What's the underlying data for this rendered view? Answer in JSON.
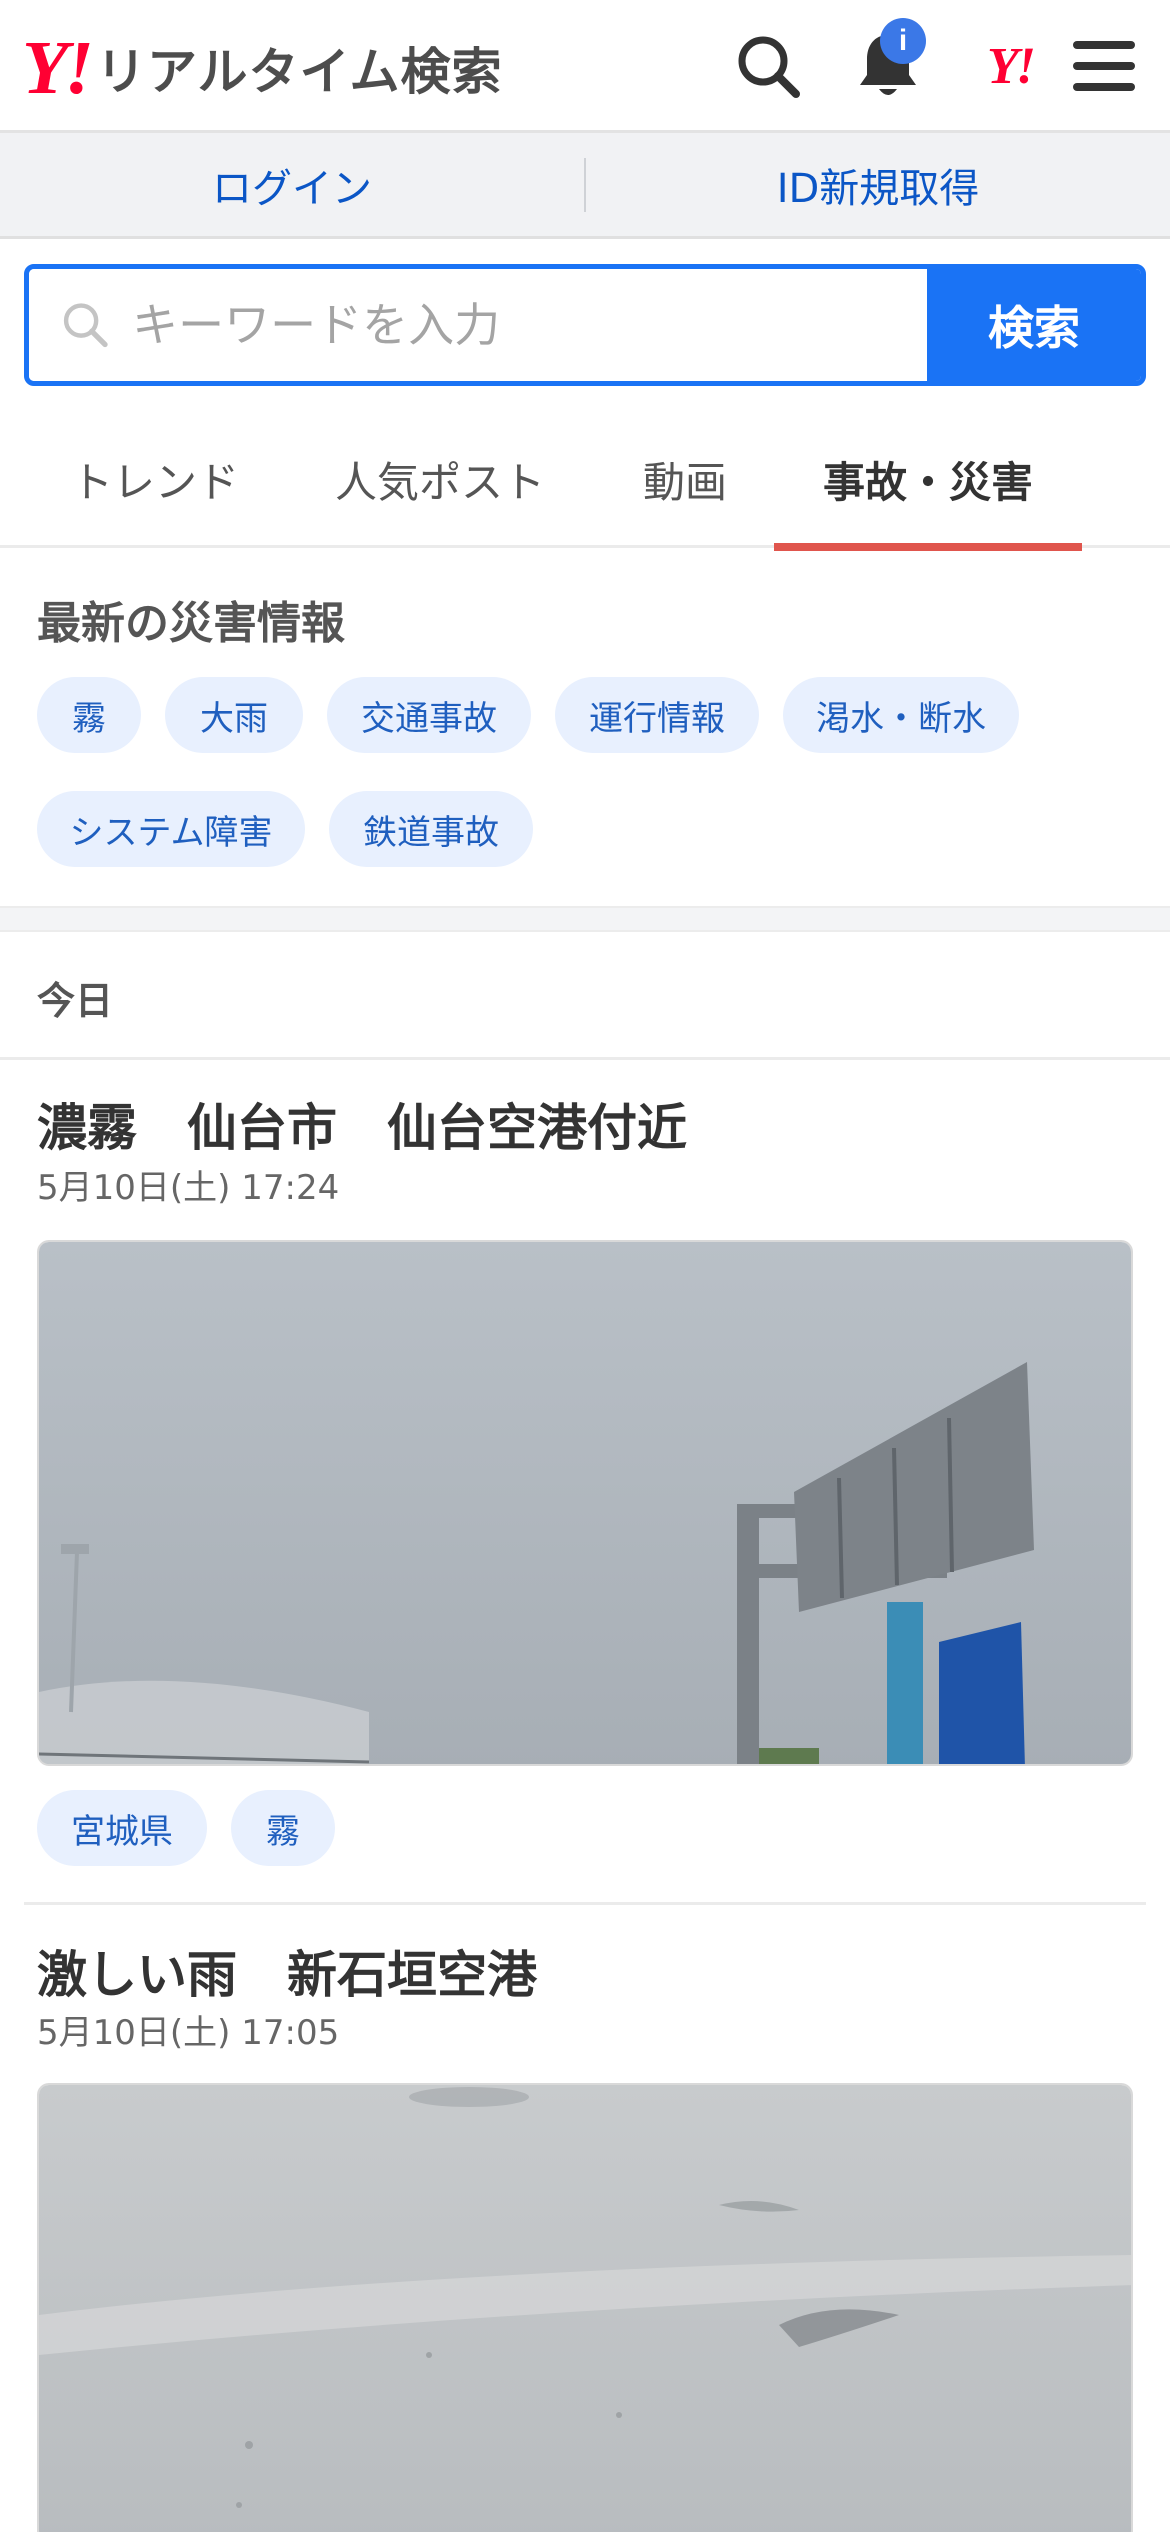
{
  "header": {
    "logo_mark": "Y!",
    "logo_text": "リアルタイム検索",
    "notification_badge": "i",
    "yahoo_mark": "Y!",
    "icons": [
      "search-icon",
      "bell-icon",
      "yahoo-icon",
      "hamburger-menu-icon"
    ]
  },
  "login_bar": {
    "login": "ログイン",
    "register": "ID新規取得"
  },
  "search": {
    "placeholder": "キーワードを入力",
    "button": "検索"
  },
  "tabs": [
    {
      "label": "トレンド",
      "active": false
    },
    {
      "label": "人気ポスト",
      "active": false
    },
    {
      "label": "動画",
      "active": false
    },
    {
      "label": "事故・災害",
      "active": true
    }
  ],
  "disaster_section": {
    "title": "最新の災害情報",
    "chips": [
      "霧",
      "大雨",
      "交通事故",
      "運行情報",
      "渇水・断水",
      "システム障害",
      "鉄道事故"
    ]
  },
  "day_label": "今日",
  "articles": [
    {
      "title": "濃霧　仙台市　仙台空港付近",
      "time": "5月10日(土) 17:24",
      "tags": [
        "宮城県",
        "霧"
      ]
    },
    {
      "title": "激しい雨　新石垣空港",
      "time": "5月10日(土) 17:05",
      "tags": []
    }
  ],
  "colors": {
    "brand_red": "#ff0033",
    "accent_blue": "#1a73f5",
    "link_blue": "#0b56c6",
    "active_tab_underline": "#e0554d",
    "chip_bg": "#e8f0fe"
  }
}
